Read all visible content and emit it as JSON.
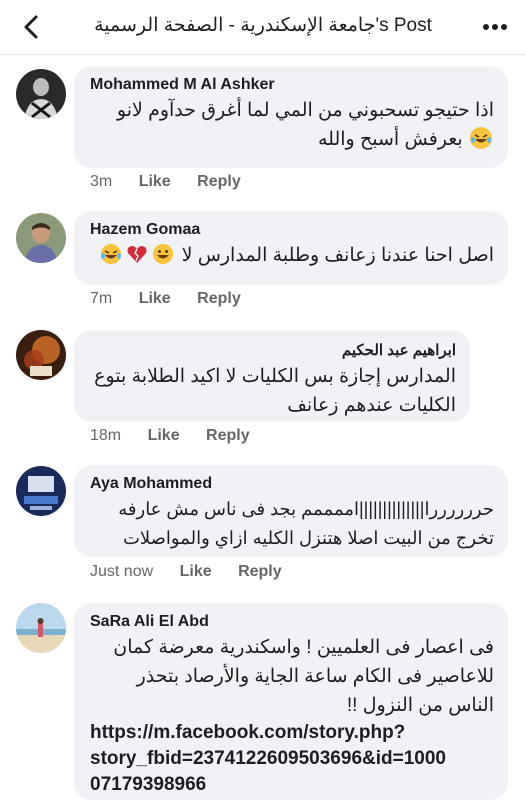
{
  "header": {
    "title": "جامعة الإسكندرية - الصفحة الرسمية's Post"
  },
  "comments": [
    {
      "author": "Mohammed M Al Ashker",
      "text_lines": [
        "اذا حتيجو تسحبوني من المي   لما أغرق حدآوم لانو",
        "بعرفش أسبح والله"
      ],
      "emoji": [
        "laughing-tears"
      ],
      "time": "3m",
      "like": "Like",
      "reply": "Reply"
    },
    {
      "author": "Hazem Gomaa",
      "text_lines": [
        "اصل احنا عندنا زعانف وطلبة المدارس لا"
      ],
      "emoji": [
        "grinning",
        "broken-heart",
        "laughing-tears"
      ],
      "time": "7m",
      "like": "Like",
      "reply": "Reply"
    },
    {
      "author": "ابراهيم عبد الحكيم",
      "text_lines": [
        "المدارس إجازة بس الكليات لا اكيد الطلابة بتوع",
        "الكليات  عندهم زعانف"
      ],
      "time": "18m",
      "like": "Like",
      "reply": "Reply"
    },
    {
      "author": "Aya Mohammed",
      "text_lines": [
        "حررررررا||||||||||||||اممممم بجد فى ناس مش عارفه",
        "تخرج من البيت اصلا هتنزل الكليه ازاي والمواصلات"
      ],
      "time": "Just now",
      "like": "Like",
      "reply": "Reply"
    },
    {
      "author": "SaRa Ali El Abd",
      "text_lines": [
        "فى اعصار فى العلميين ! واسكندرية معرضة كمان",
        "للاعاصير فى الكام ساعة الجاية والأرصاد بتحذر",
        "الناس من النزول !!"
      ],
      "link_lines": [
        "https://m.facebook.com/story.php?",
        "story_fbid=2374122609503696&id=1000",
        "07179398966"
      ]
    }
  ],
  "colors": {
    "bubble": "#f0f2f5",
    "meta": "#65676b",
    "text": "#1c1e21"
  }
}
